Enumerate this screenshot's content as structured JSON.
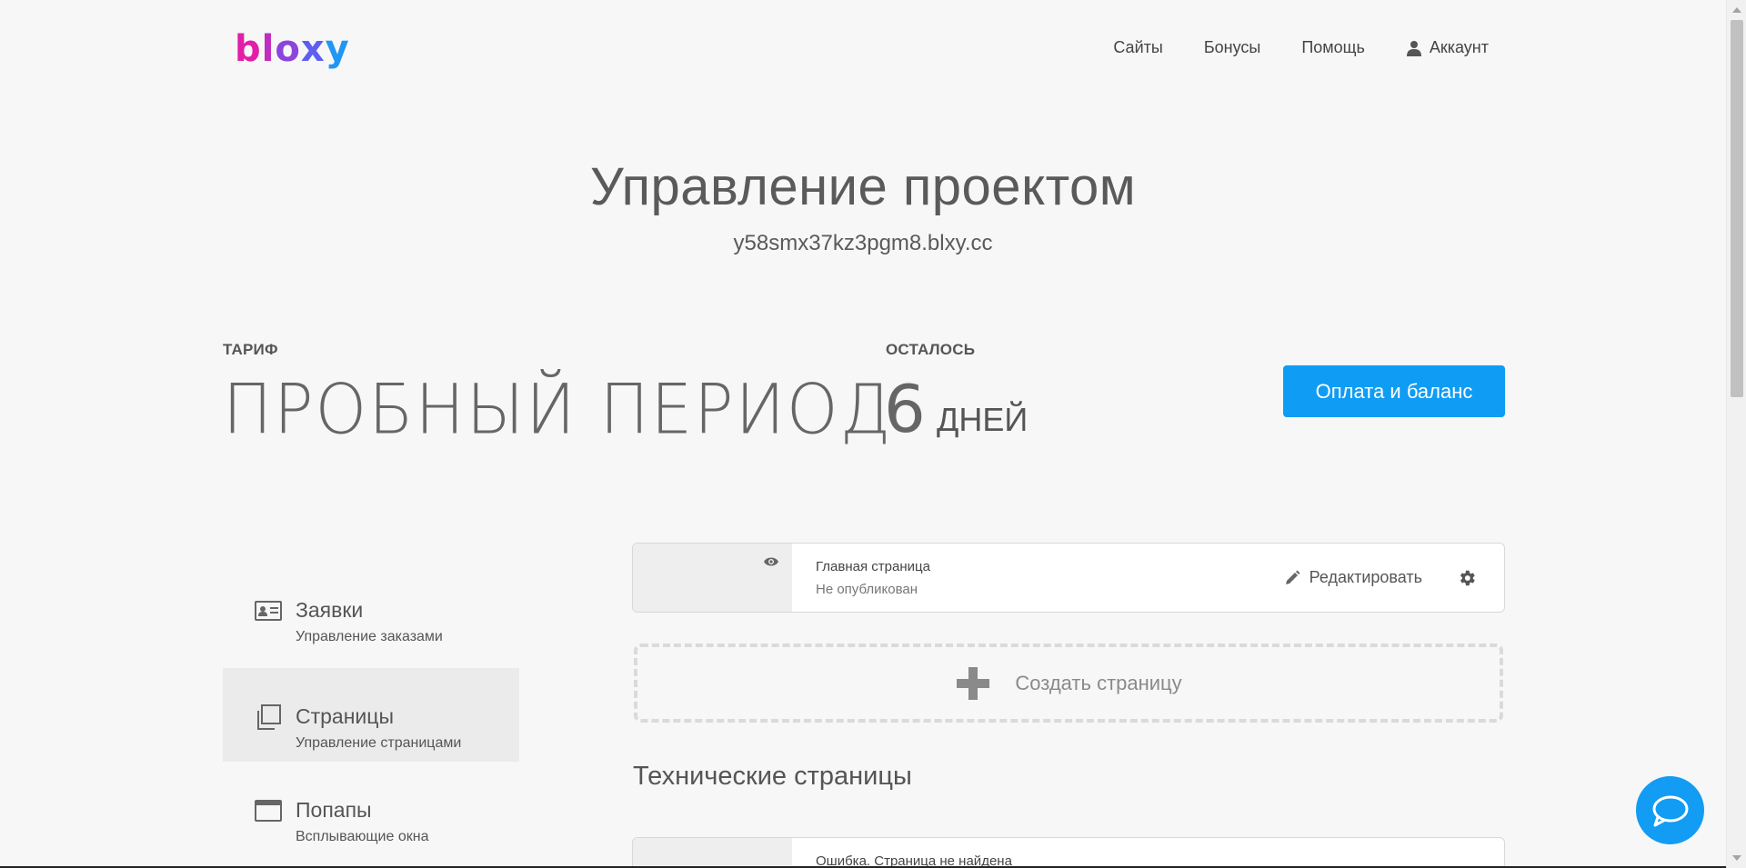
{
  "header": {
    "logo_letters": [
      "b",
      "l",
      "o",
      "x",
      "y"
    ],
    "nav": {
      "sites": "Сайты",
      "bonuses": "Бонусы",
      "help": "Помощь",
      "account": "Аккаунт"
    }
  },
  "project": {
    "title": "Управление проектом",
    "domain": "y58smx37kz3pgm8.blxy.cc"
  },
  "plan": {
    "tariff_label": "ТАРИФ",
    "tariff_value": "ПРОБНЫЙ ПЕРИОД",
    "remaining_label": "ОСТАЛОСЬ",
    "remaining_number": "6",
    "remaining_unit": "ДНЕЙ",
    "pay_button": "Оплата и баланс"
  },
  "sidebar": {
    "items": [
      {
        "name": "Заявки",
        "desc": "Управление заказами",
        "active": false,
        "icon": "id-card-icon"
      },
      {
        "name": "Страницы",
        "desc": "Управление страницами",
        "active": true,
        "icon": "pages-icon"
      },
      {
        "name": "Попапы",
        "desc": "Всплывающие окна",
        "active": false,
        "icon": "window-icon"
      }
    ]
  },
  "pages": {
    "items": [
      {
        "name": "Главная страница",
        "status": "Не опубликован",
        "edit_label": "Редактировать"
      }
    ],
    "create_label": "Создать страницу",
    "technical_title": "Технические страницы",
    "technical_items": [
      {
        "name": "Ошибка. Страница не найдена"
      }
    ]
  },
  "colors": {
    "accent": "#0f9cf5",
    "chat": "#129cf3",
    "background": "#f7f7f7"
  }
}
